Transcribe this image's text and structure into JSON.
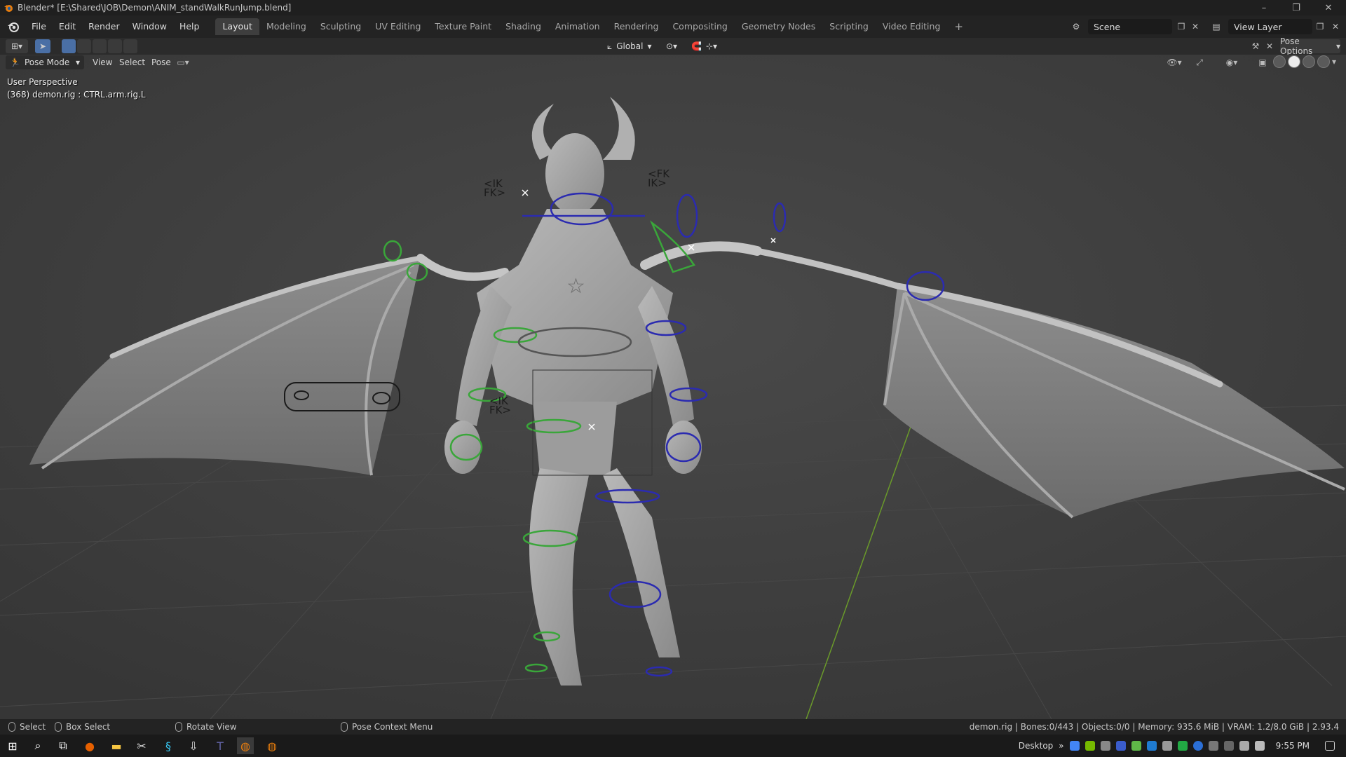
{
  "window": {
    "title": "Blender* [E:\\Shared\\JOB\\Demon\\ANIM_standWalkRunJump.blend]",
    "min_label": "–",
    "max_label": "❐",
    "close_label": "✕"
  },
  "menu": [
    "File",
    "Edit",
    "Render",
    "Window",
    "Help"
  ],
  "workspaces": {
    "tabs": [
      "Layout",
      "Modeling",
      "Sculpting",
      "UV Editing",
      "Texture Paint",
      "Shading",
      "Animation",
      "Rendering",
      "Compositing",
      "Geometry Nodes",
      "Scripting",
      "Video Editing"
    ],
    "active": "Layout",
    "add_label": "+"
  },
  "scene": {
    "name": "Scene",
    "view_layer": "View Layer"
  },
  "header": {
    "orientation": "Global",
    "pose_options": "Pose Options"
  },
  "viewport": {
    "mode": "Pose Mode",
    "menus": [
      "View",
      "Select",
      "Pose"
    ],
    "perspective_label": "User Perspective",
    "active_info": "(368) demon.rig : CTRL.arm.rig.L",
    "ik_fk_left": [
      "<IK",
      "FK>"
    ],
    "fk_ik_right": [
      "<FK",
      "IK>"
    ],
    "ik_fk_hand": [
      "<IK",
      "FK>"
    ]
  },
  "statusbar": {
    "select": "Select",
    "box_select": "Box Select",
    "rotate_view": "Rotate View",
    "context_menu": "Pose Context Menu",
    "stats": "demon.rig | Bones:0/443 | Objects:0/0 | Memory: 935.6 MiB | VRAM: 1.2/8.0 GiB | 2.93.4"
  },
  "taskbar": {
    "desktop_label": "Desktop",
    "chevron": "»",
    "time": "9:55 PM"
  },
  "colors": {
    "accent_blue": "#4a6fa5",
    "viewport_bg": "#3d3d3d",
    "grid_green": "#6a9a2a",
    "bone_green": "#3aa63a",
    "bone_blue": "#2b2bb0"
  }
}
